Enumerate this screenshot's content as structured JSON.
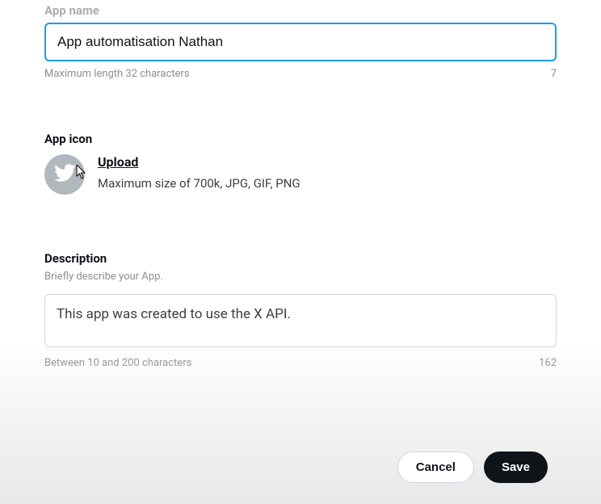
{
  "appName": {
    "label": "App name",
    "value": "App automatisation Nathan",
    "helper": "Maximum length 32 characters",
    "remaining": "7"
  },
  "appIcon": {
    "label": "App icon",
    "uploadLabel": "Upload",
    "hint": "Maximum size of 700k, JPG, GIF, PNG"
  },
  "description": {
    "label": "Description",
    "subLabel": "Briefly describe your App.",
    "value": "This app was created to use the X API.",
    "helper": "Between 10 and 200 characters",
    "remaining": "162"
  },
  "buttons": {
    "cancel": "Cancel",
    "save": "Save"
  }
}
